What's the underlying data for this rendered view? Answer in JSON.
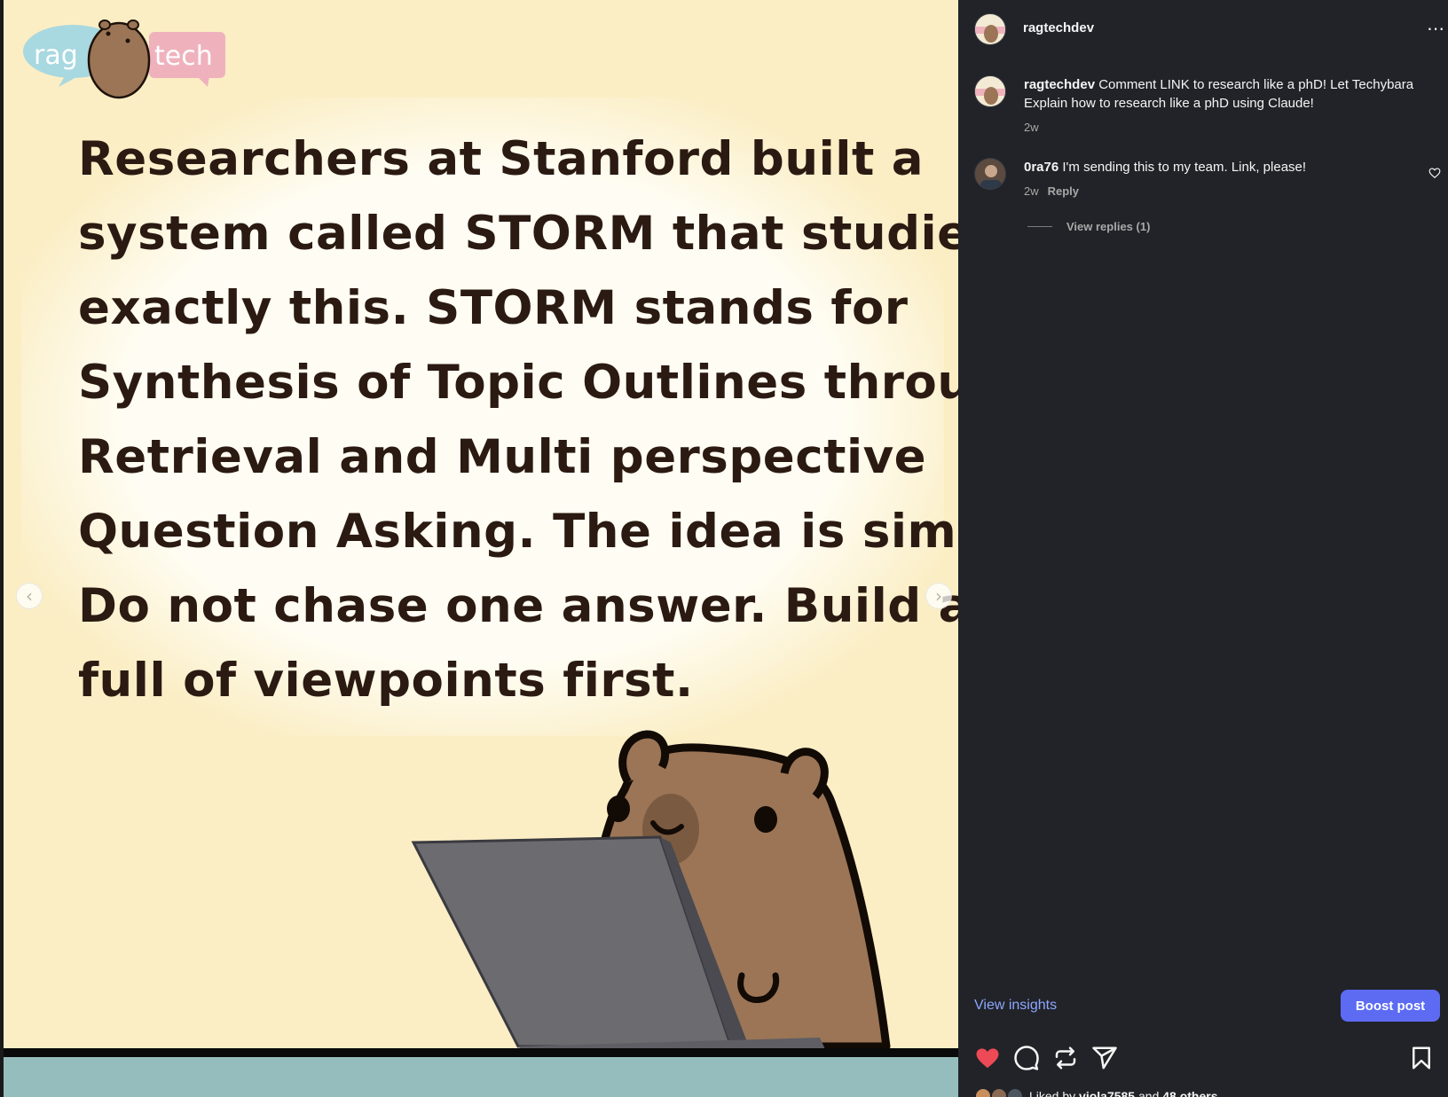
{
  "post": {
    "logo_left": "rag",
    "logo_right": "tech",
    "slide_lines": [
      "Researchers at Stanford built a",
      "system called STORM that studies",
      "exactly this. STORM stands for",
      "Synthesis of Topic Outlines through",
      "Retrieval and Multi perspective",
      "Question Asking. The idea is simple.",
      "Do not chase one answer. Build a room",
      "full of viewpoints first."
    ],
    "prev_arrow": "‹",
    "next_arrow": "›"
  },
  "header": {
    "username": "ragtechdev",
    "more": "⋯"
  },
  "caption": {
    "username": "ragtechdev",
    "text": "Comment LINK to research like a phD! Let Techybara Explain how to research like a phD using Claude!",
    "time": "2w"
  },
  "comments": [
    {
      "username": "0ra76",
      "text": "I'm sending this to my team. Link, please!",
      "time": "2w",
      "reply_label": "Reply",
      "view_replies": "View replies (1)"
    }
  ],
  "actions": {
    "insights_label": "View insights",
    "boost_label": "Boost post",
    "liked_prefix": "Liked by",
    "liked_user": "viola7585",
    "liked_middle": "and",
    "liked_others": "48 others",
    "like_color": "#ed4956",
    "accent_color": "#5c6bf2"
  }
}
